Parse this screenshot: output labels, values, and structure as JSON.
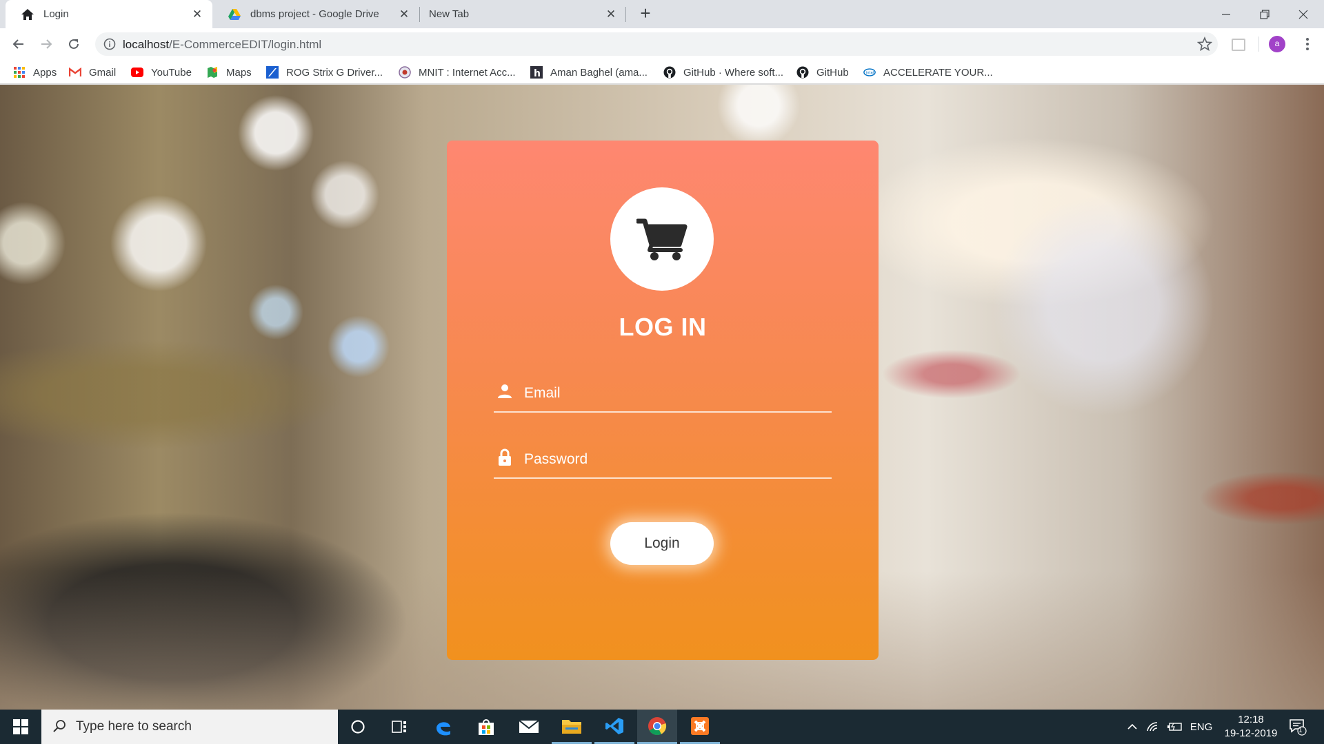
{
  "browser": {
    "tabs": [
      {
        "title": "Login",
        "icon": "home-icon"
      },
      {
        "title": "dbms project - Google Drive",
        "icon": "google-drive-icon"
      },
      {
        "title": "New Tab",
        "icon": ""
      }
    ],
    "address": {
      "host": "localhost",
      "path": "/E-CommerceEDIT/login.html"
    },
    "profile_initial": "a",
    "bookmarks": [
      {
        "label": "Apps",
        "icon": "apps-grid-icon"
      },
      {
        "label": "Gmail",
        "icon": "gmail-icon"
      },
      {
        "label": "YouTube",
        "icon": "youtube-icon"
      },
      {
        "label": "Maps",
        "icon": "maps-icon"
      },
      {
        "label": "ROG Strix G Driver...",
        "icon": "asus-icon"
      },
      {
        "label": "MNIT : Internet Acc...",
        "icon": "mnit-icon"
      },
      {
        "label": "Aman Baghel (ama...",
        "icon": "hackerrank-icon"
      },
      {
        "label": "GitHub · Where soft...",
        "icon": "github-icon"
      },
      {
        "label": "GitHub",
        "icon": "github-icon"
      },
      {
        "label": "ACCELERATE YOUR...",
        "icon": "intel-icon"
      }
    ]
  },
  "login": {
    "heading": "LOG IN",
    "email_placeholder": "Email",
    "password_placeholder": "Password",
    "button_label": "Login",
    "icon": "shopping-cart-icon",
    "colors": {
      "card_top": "#fe8771",
      "card_bottom": "#f1911e",
      "text": "#ffffff"
    }
  },
  "taskbar": {
    "search_placeholder": "Type here to search",
    "apps": [
      "cortana-icon",
      "task-view-icon",
      "edge-icon",
      "store-icon",
      "mail-icon",
      "file-explorer-icon",
      "vscode-icon",
      "chrome-icon",
      "xampp-icon"
    ],
    "language": "ENG",
    "time": "12:18",
    "date": "19-12-2019",
    "notification_count": "1"
  }
}
